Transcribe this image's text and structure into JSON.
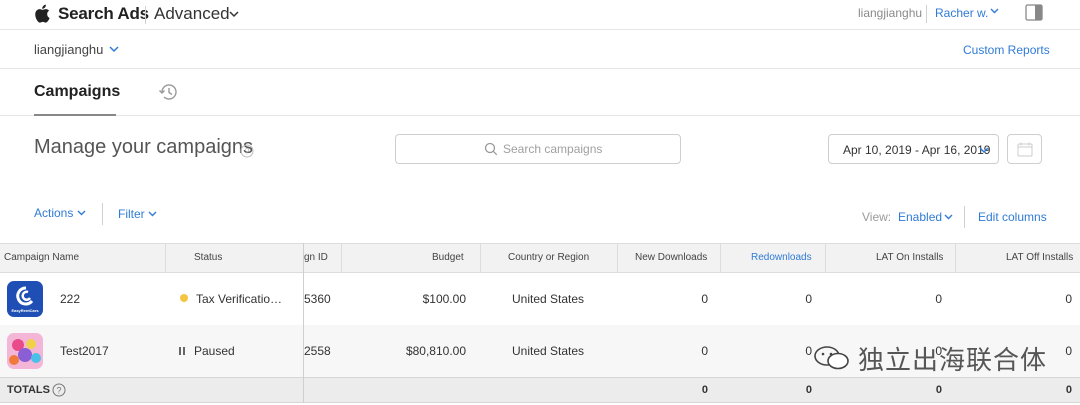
{
  "header": {
    "brand": "Search Ads",
    "mode": "Advanced",
    "account_user": "liangjianghu",
    "user_name": "Racher w."
  },
  "account_bar": {
    "account": "liangjianghu",
    "custom_reports": "Custom Reports"
  },
  "tabs": {
    "campaigns": "Campaigns"
  },
  "toolbar": {
    "title": "Manage your campaigns",
    "search_placeholder": "Search campaigns",
    "date_range": "Apr 10, 2019 - Apr 16, 2019"
  },
  "actions_bar": {
    "actions": "Actions",
    "filter": "Filter",
    "view_label": "View:",
    "view_value": "Enabled",
    "edit_columns": "Edit columns"
  },
  "table": {
    "columns": [
      "Campaign Name",
      "Status",
      "gn ID",
      "Budget",
      "Country or Region",
      "New Downloads",
      "Redownloads",
      "LAT On Installs",
      "LAT Off Installs"
    ],
    "rows": [
      {
        "name": "222",
        "app_icon_text": "EasyRentCars",
        "status": "Tax Verificatio…",
        "id": "5360",
        "budget": "$100.00",
        "country": "United States",
        "new_downloads": "0",
        "redownloads": "0",
        "lat_on": "0",
        "lat_off": "0"
      },
      {
        "name": "Test2017",
        "status": "Paused",
        "id": "2558",
        "budget": "$80,810.00",
        "country": "United States",
        "new_downloads": "0",
        "redownloads": "0",
        "lat_on": "0",
        "lat_off": "0"
      }
    ],
    "totals": {
      "label": "TOTALS",
      "new_downloads": "0",
      "redownloads": "0",
      "lat_on": "0",
      "lat_off": "0"
    }
  },
  "watermark": "独立出海联合体",
  "colors": {
    "link": "#2f7bd6",
    "header_bg": "#f2f2f2",
    "status_warning": "#f5c542"
  }
}
